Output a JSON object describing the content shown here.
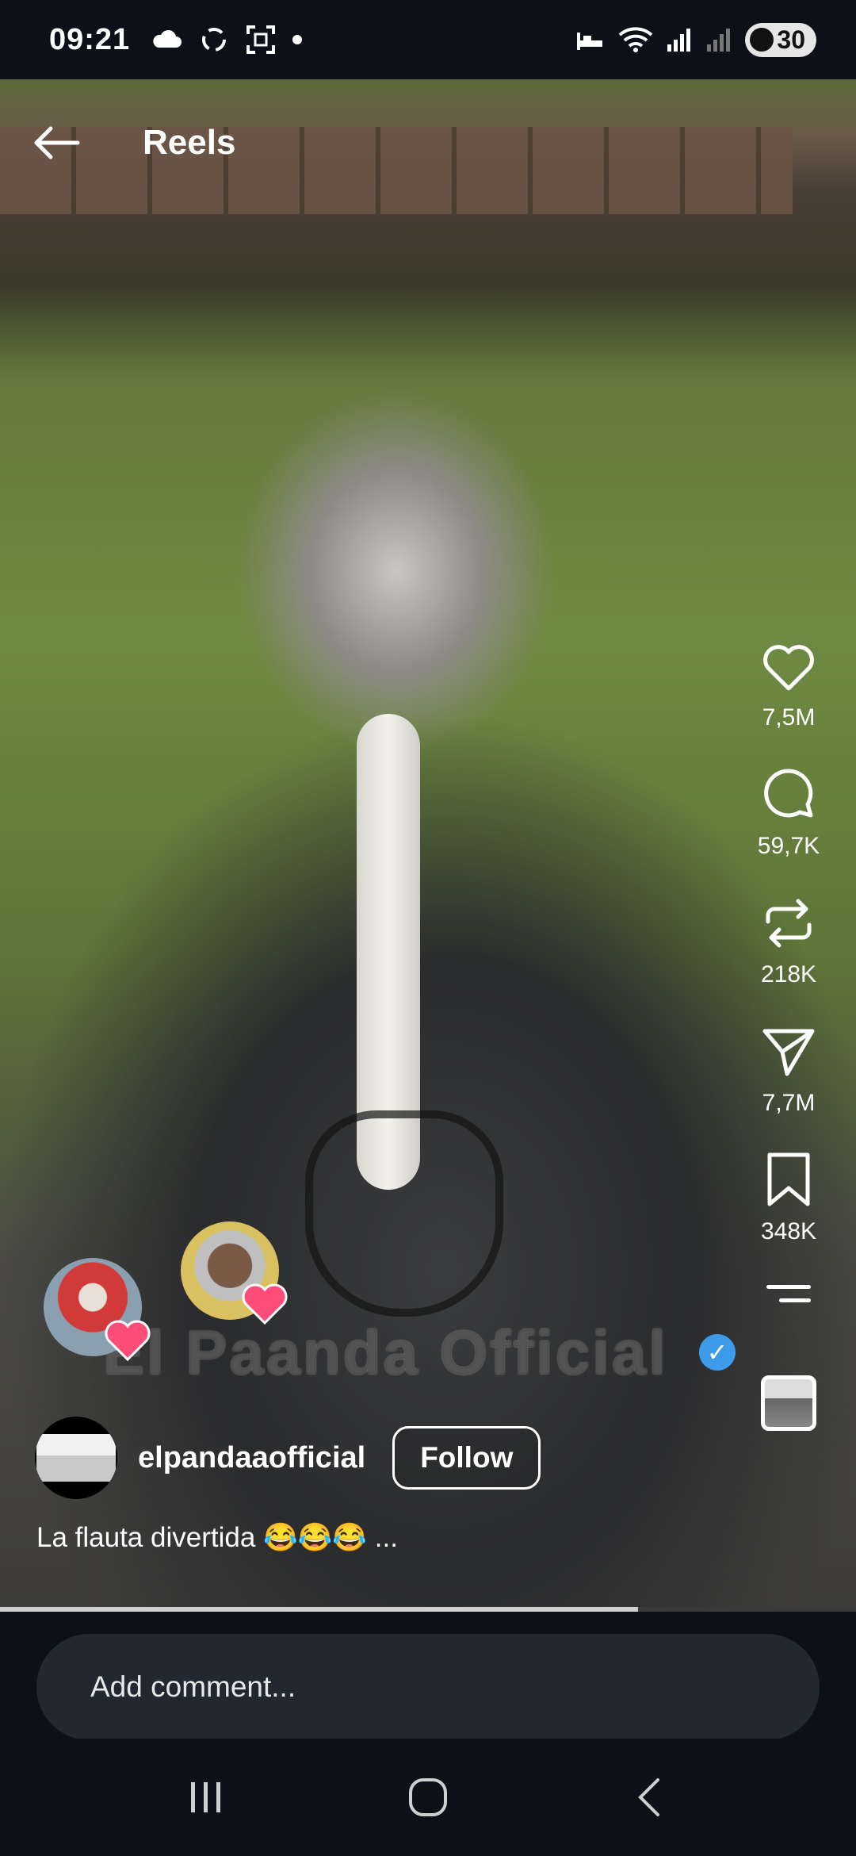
{
  "status_bar": {
    "time": "09:21",
    "battery": "30",
    "left_icons": [
      "cloud-icon",
      "sync-icon",
      "scan-icon",
      "dot-icon"
    ],
    "right_icons": [
      "sleep-icon",
      "wifi-icon",
      "signal-icon",
      "signal-weak-icon"
    ]
  },
  "header": {
    "title": "Reels"
  },
  "video": {
    "watermark_text": "El Paanda Official",
    "progress": 0.745
  },
  "actions": {
    "likes": "7,5M",
    "comments": "59,7K",
    "reposts": "218K",
    "shares": "7,7M",
    "saves": "348K"
  },
  "author": {
    "username": "elpandaaofficial",
    "follow_label": "Follow"
  },
  "caption": {
    "text": "La flauta divertida 😂😂😂",
    "more": "..."
  },
  "comment": {
    "placeholder": "Add comment..."
  },
  "colors": {
    "background": "#0d1117",
    "verified": "#3d9be9",
    "heart_badge": "#ff4d79"
  }
}
